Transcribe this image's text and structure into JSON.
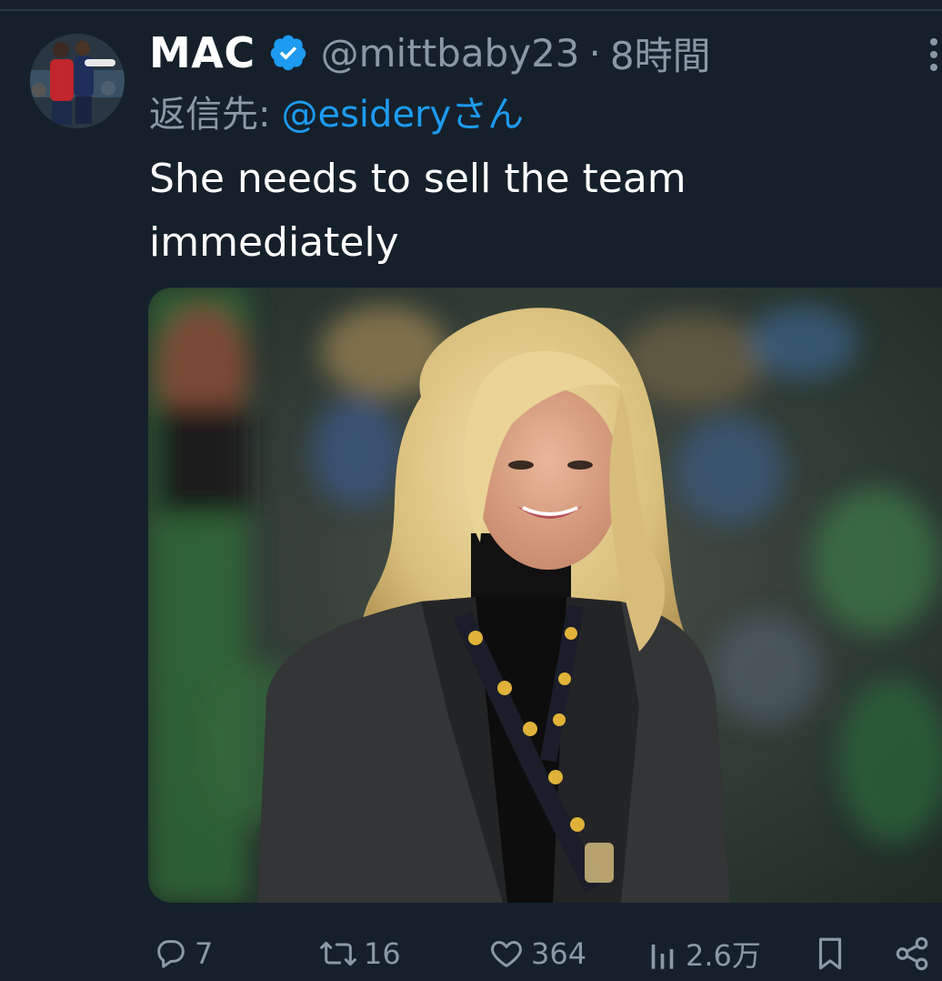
{
  "tweet": {
    "display_name": "MAC",
    "handle": "@mittbaby23",
    "separator": "·",
    "time": "8時間",
    "reply_prefix": "返信先:",
    "reply_mention": "@esideryさん",
    "text": "She needs to sell the team immediately",
    "verified": true
  },
  "icons": {
    "verified": "verified-badge-icon",
    "more": "more-vertical-icon",
    "reply": "reply-icon",
    "retweet": "retweet-icon",
    "like": "heart-icon",
    "views": "views-bar-icon",
    "bookmark": "bookmark-icon",
    "share": "share-icon"
  },
  "metrics": {
    "replies": "7",
    "retweets": "16",
    "likes": "364",
    "views": "2.6万"
  },
  "colors": {
    "background": "#15202b",
    "text_primary": "#ffffff",
    "text_secondary": "#8b98a5",
    "accent": "#1d9bf0"
  }
}
